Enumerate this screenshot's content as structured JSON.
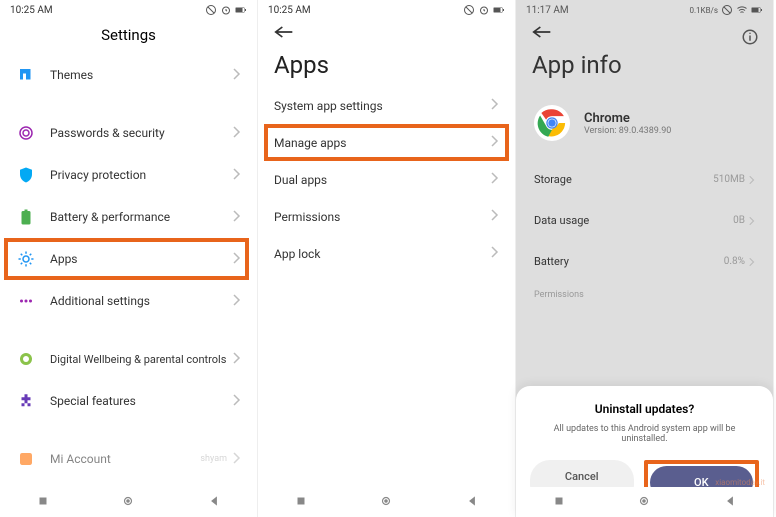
{
  "screen1": {
    "time": "10:25 AM",
    "title": "Settings",
    "items": [
      {
        "icon": "themes",
        "label": "Themes"
      },
      {
        "icon": "passwords",
        "label": "Passwords & security"
      },
      {
        "icon": "privacy",
        "label": "Privacy protection"
      },
      {
        "icon": "battery",
        "label": "Battery & performance"
      },
      {
        "icon": "apps",
        "label": "Apps"
      },
      {
        "icon": "additional",
        "label": "Additional settings"
      },
      {
        "icon": "wellbeing",
        "label": "Digital Wellbeing & parental controls"
      },
      {
        "icon": "special",
        "label": "Special features"
      },
      {
        "icon": "account",
        "label": "Mi Account"
      }
    ],
    "footer_label": "shyam"
  },
  "screen2": {
    "time": "10:25 AM",
    "title": "Apps",
    "items": [
      {
        "label": "System app settings"
      },
      {
        "label": "Manage apps"
      },
      {
        "label": "Dual apps"
      },
      {
        "label": "Permissions"
      },
      {
        "label": "App lock"
      }
    ]
  },
  "screen3": {
    "time": "11:17 AM",
    "net": "0.1KB/s",
    "title": "App info",
    "app": {
      "name": "Chrome",
      "version": "Version: 89.0.4389.90"
    },
    "rows": [
      {
        "label": "Storage",
        "value": "510MB"
      },
      {
        "label": "Data usage",
        "value": "0B"
      },
      {
        "label": "Battery",
        "value": "0.8%"
      }
    ],
    "section": "Permissions",
    "dialog": {
      "title": "Uninstall updates?",
      "message": "All updates to this Android system app will be uninstalled.",
      "cancel": "Cancel",
      "ok": "OK"
    }
  },
  "watermark": "xiaomitoday.it"
}
